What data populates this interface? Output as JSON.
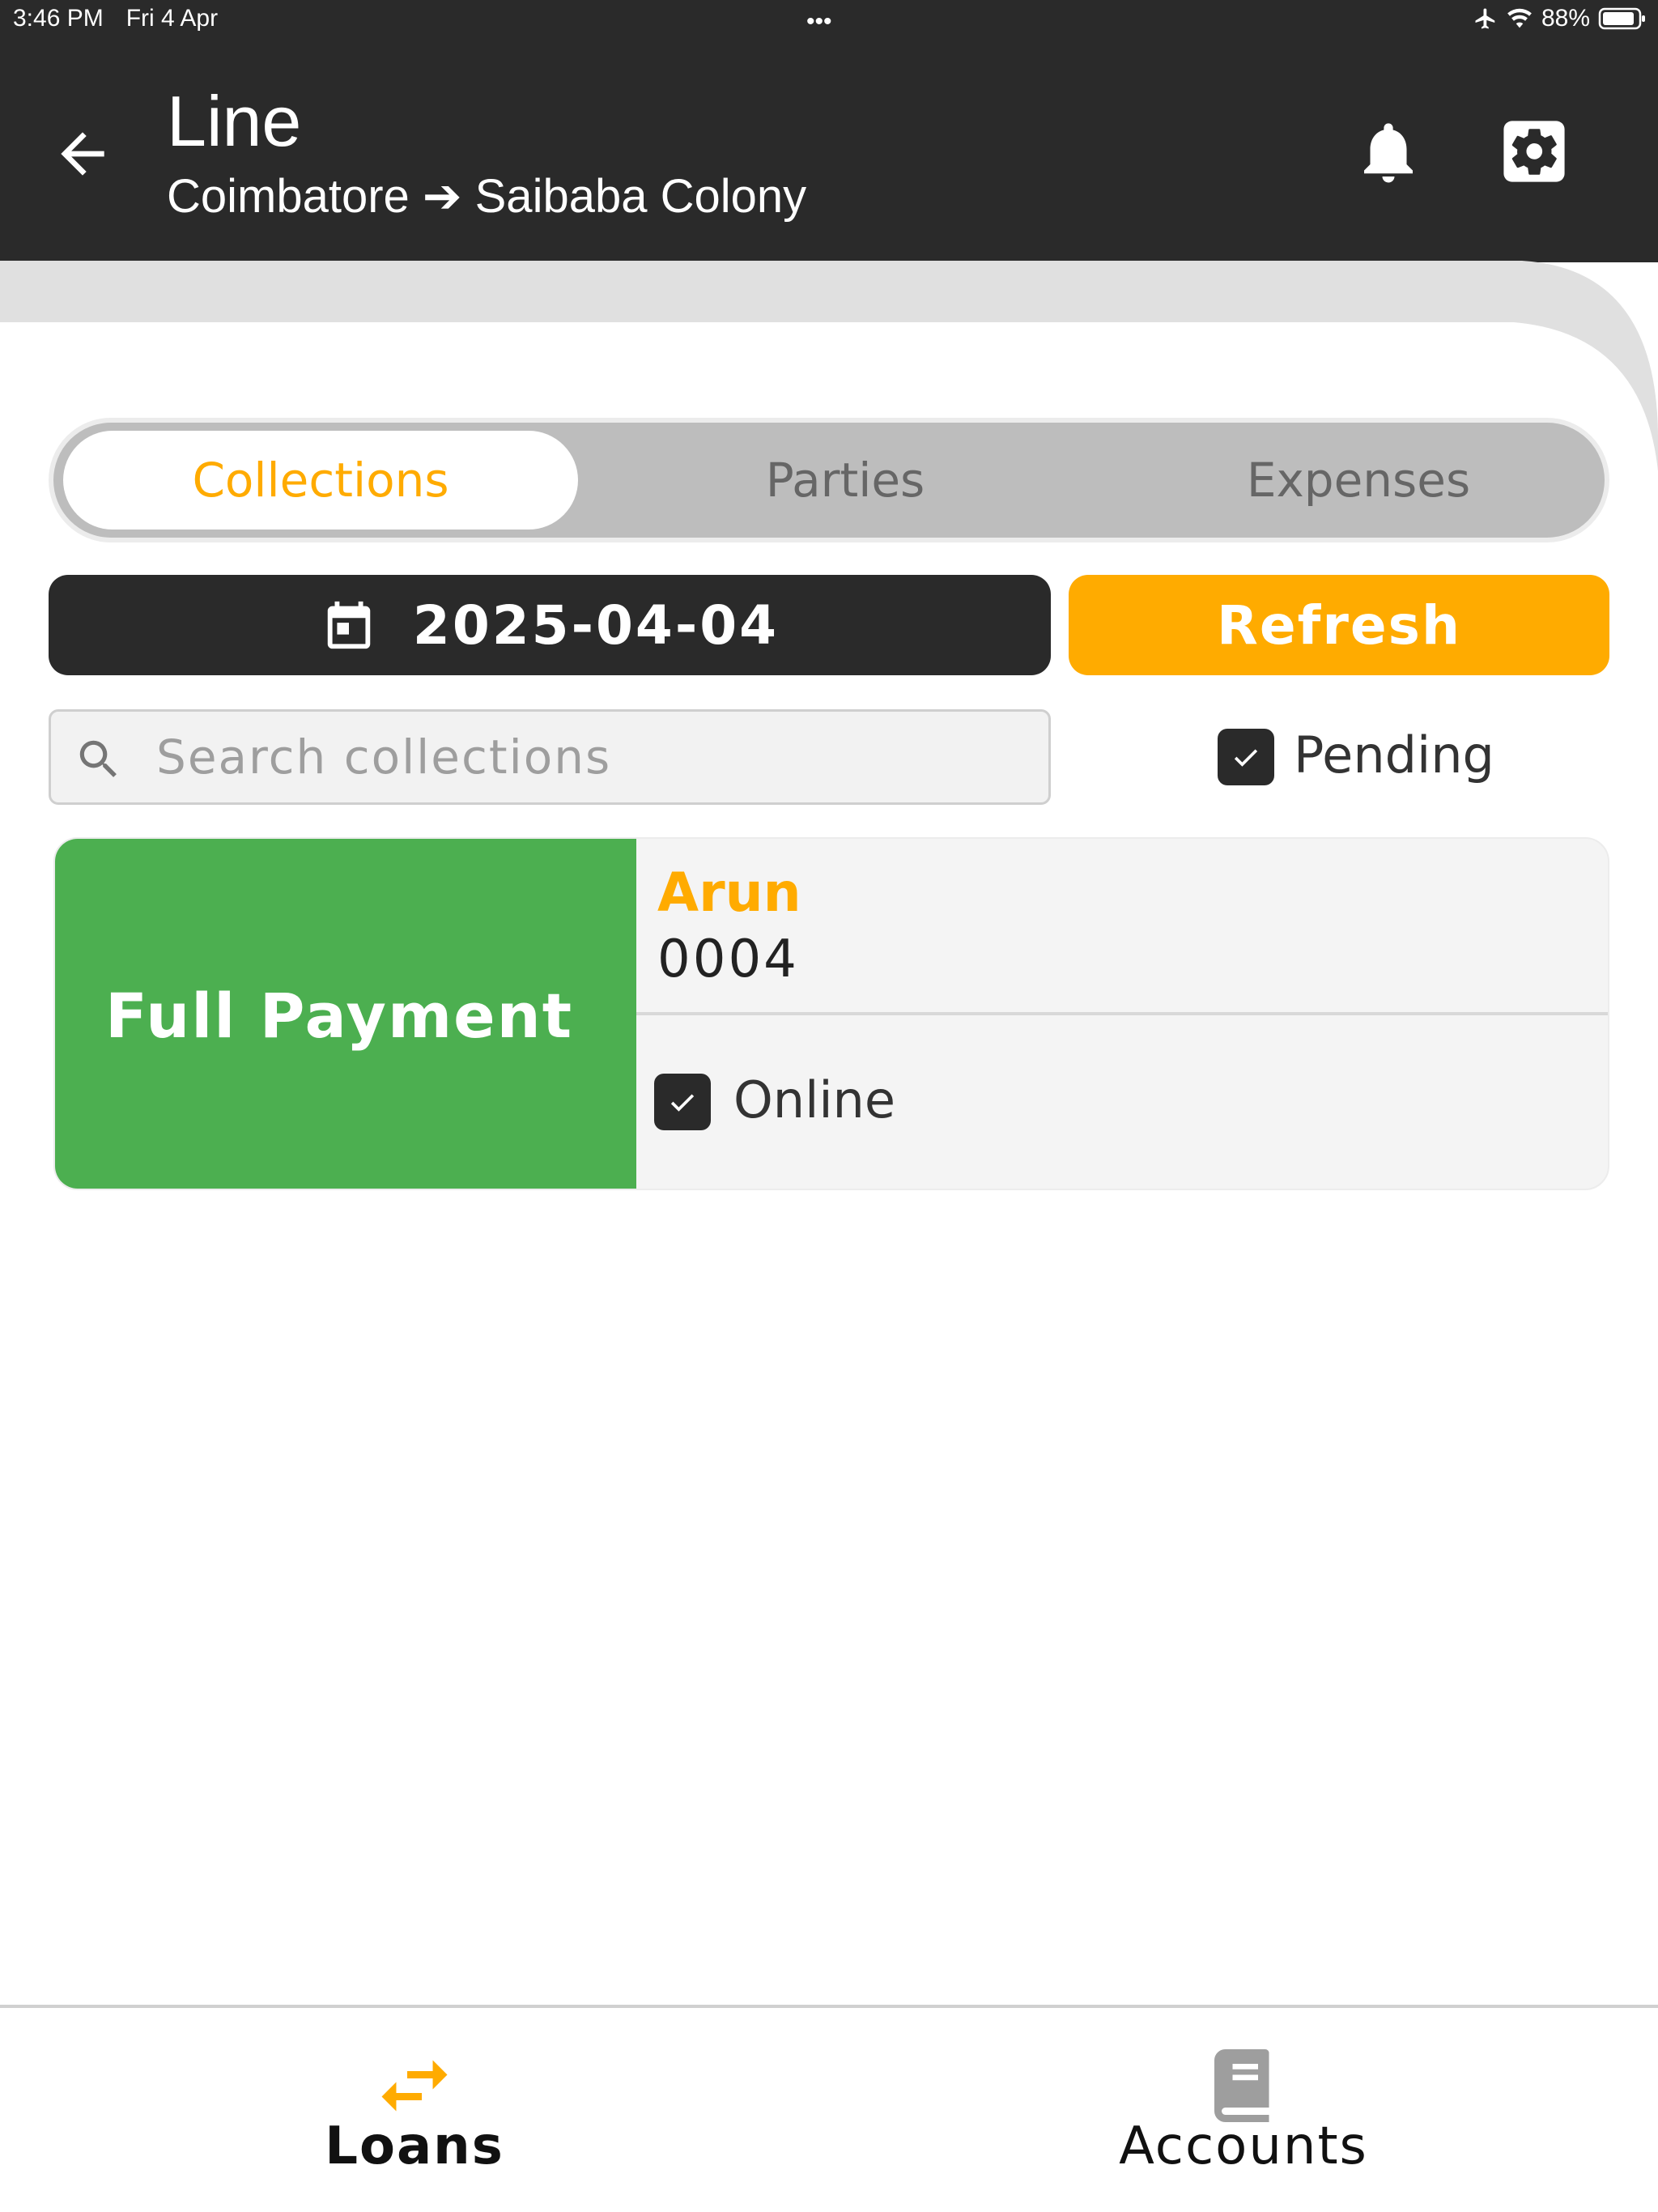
{
  "status_bar": {
    "time": "3:46 PM",
    "date": "Fri 4 Apr",
    "dots": "•••",
    "battery": "88%"
  },
  "header": {
    "title": "Line",
    "subtitle": "Coimbatore ➔ Saibaba Colony",
    "icons": [
      "arrow-left-icon",
      "bell-icon",
      "gear-icon"
    ]
  },
  "tabs": [
    {
      "label": "Collections",
      "active": true
    },
    {
      "label": "Parties",
      "active": false
    },
    {
      "label": "Expenses",
      "active": false
    }
  ],
  "filters": {
    "date": "2025-04-04",
    "refresh_label": "Refresh",
    "search_placeholder": "Search collections",
    "pending_label": "Pending",
    "pending_checked": true
  },
  "collections": [
    {
      "status": "Full Payment",
      "status_color": "#4caf50",
      "name": "Arun",
      "loan_no": "0004",
      "online_label": "Online",
      "online_checked": true
    }
  ],
  "bottom_nav": [
    {
      "label": "Loans",
      "icon": "swap-arrows-icon",
      "active": true
    },
    {
      "label": "Accounts",
      "icon": "book-icon",
      "active": false
    }
  ],
  "colors": {
    "header_bg": "#2a2a2a",
    "accent": "#ffab00",
    "success": "#4caf50"
  }
}
